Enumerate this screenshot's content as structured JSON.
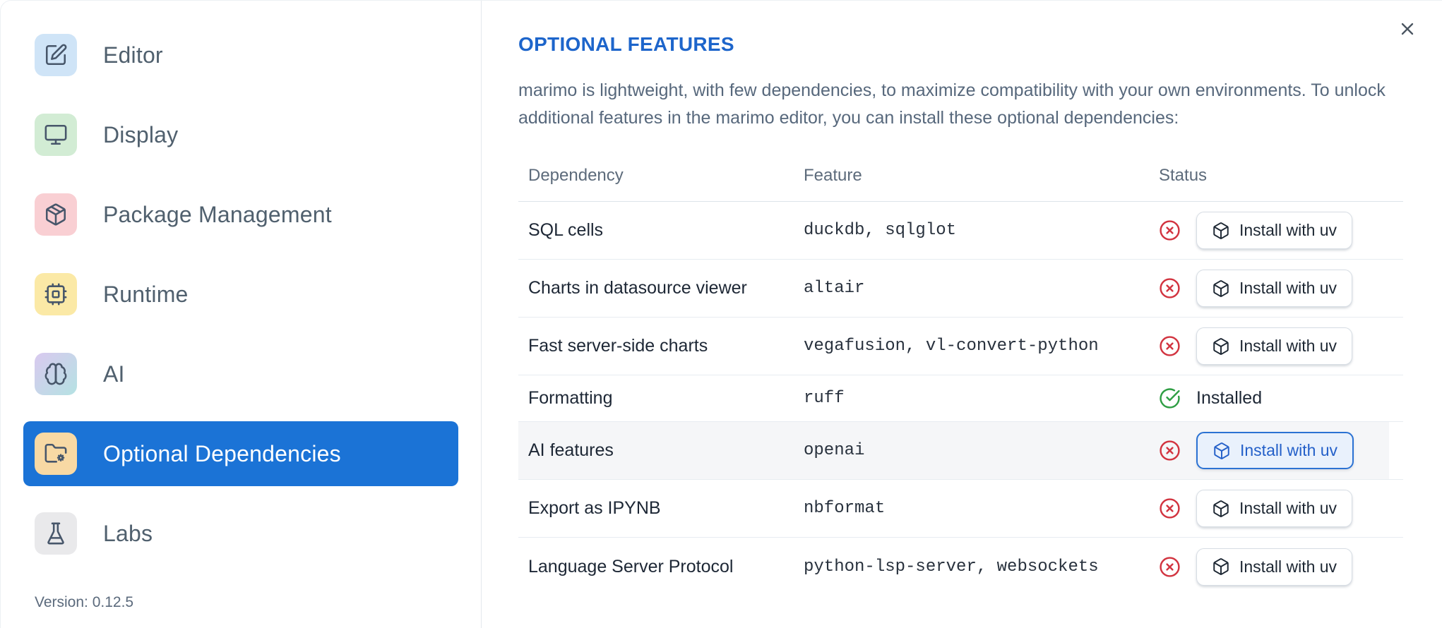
{
  "sidebar": {
    "items": [
      {
        "label": "Editor",
        "icon": "edit-icon",
        "icon_bg": "#cfe4f7",
        "selected": false
      },
      {
        "label": "Display",
        "icon": "monitor-icon",
        "icon_bg": "#d2ecd4",
        "selected": false
      },
      {
        "label": "Package Management",
        "icon": "package-icon",
        "icon_bg": "#f9cfd3",
        "selected": false
      },
      {
        "label": "Runtime",
        "icon": "cpu-icon",
        "icon_bg": "#fbe9a6",
        "selected": false
      },
      {
        "label": "AI",
        "icon": "brain-icon",
        "icon_bg": "linear-gradient(135deg,#d9c9ef,#b5e2e3)",
        "selected": false
      },
      {
        "label": "Optional Dependencies",
        "icon": "folder-gear-icon",
        "icon_bg": "#f8d9a4",
        "selected": true
      },
      {
        "label": "Labs",
        "icon": "flask-icon",
        "icon_bg": "#e9e9eb",
        "selected": false
      }
    ],
    "version_label": "Version: 0.12.5"
  },
  "panel": {
    "title": "OPTIONAL FEATURES",
    "description": "marimo is lightweight, with few dependencies, to maximize compatibility with your own environments. To unlock additional features in the marimo editor, you can install these optional dependencies:",
    "close_icon": "x-icon",
    "table": {
      "columns": [
        "Dependency",
        "Feature",
        "Status"
      ],
      "rows": [
        {
          "dependency": "SQL cells",
          "feature": "duckdb, sqlglot",
          "installed": false,
          "status_icon": "circle-x-icon",
          "action": "Install with uv"
        },
        {
          "dependency": "Charts in datasource viewer",
          "feature": "altair",
          "installed": false,
          "status_icon": "circle-x-icon",
          "action": "Install with uv"
        },
        {
          "dependency": "Fast server-side charts",
          "feature": "vegafusion, vl-convert-python",
          "installed": false,
          "status_icon": "circle-x-icon",
          "action": "Install with uv"
        },
        {
          "dependency": "Formatting",
          "feature": "ruff",
          "installed": true,
          "status_icon": "circle-check-icon",
          "status_label": "Installed"
        },
        {
          "dependency": "AI features",
          "feature": "openai",
          "installed": false,
          "status_icon": "circle-x-icon",
          "action": "Install with uv",
          "focused": true
        },
        {
          "dependency": "Export as IPYNB",
          "feature": "nbformat",
          "installed": false,
          "status_icon": "circle-x-icon",
          "action": "Install with uv"
        },
        {
          "dependency": "Language Server Protocol",
          "feature": "python-lsp-server, websockets",
          "installed": false,
          "status_icon": "circle-x-icon",
          "action": "Install with uv"
        }
      ]
    }
  },
  "colors": {
    "accent_blue": "#1b73d6",
    "title_blue": "#1d65cb",
    "error_red": "#d23440",
    "success_green": "#2f9e44",
    "focused_button_blue": "#2b72d3"
  }
}
